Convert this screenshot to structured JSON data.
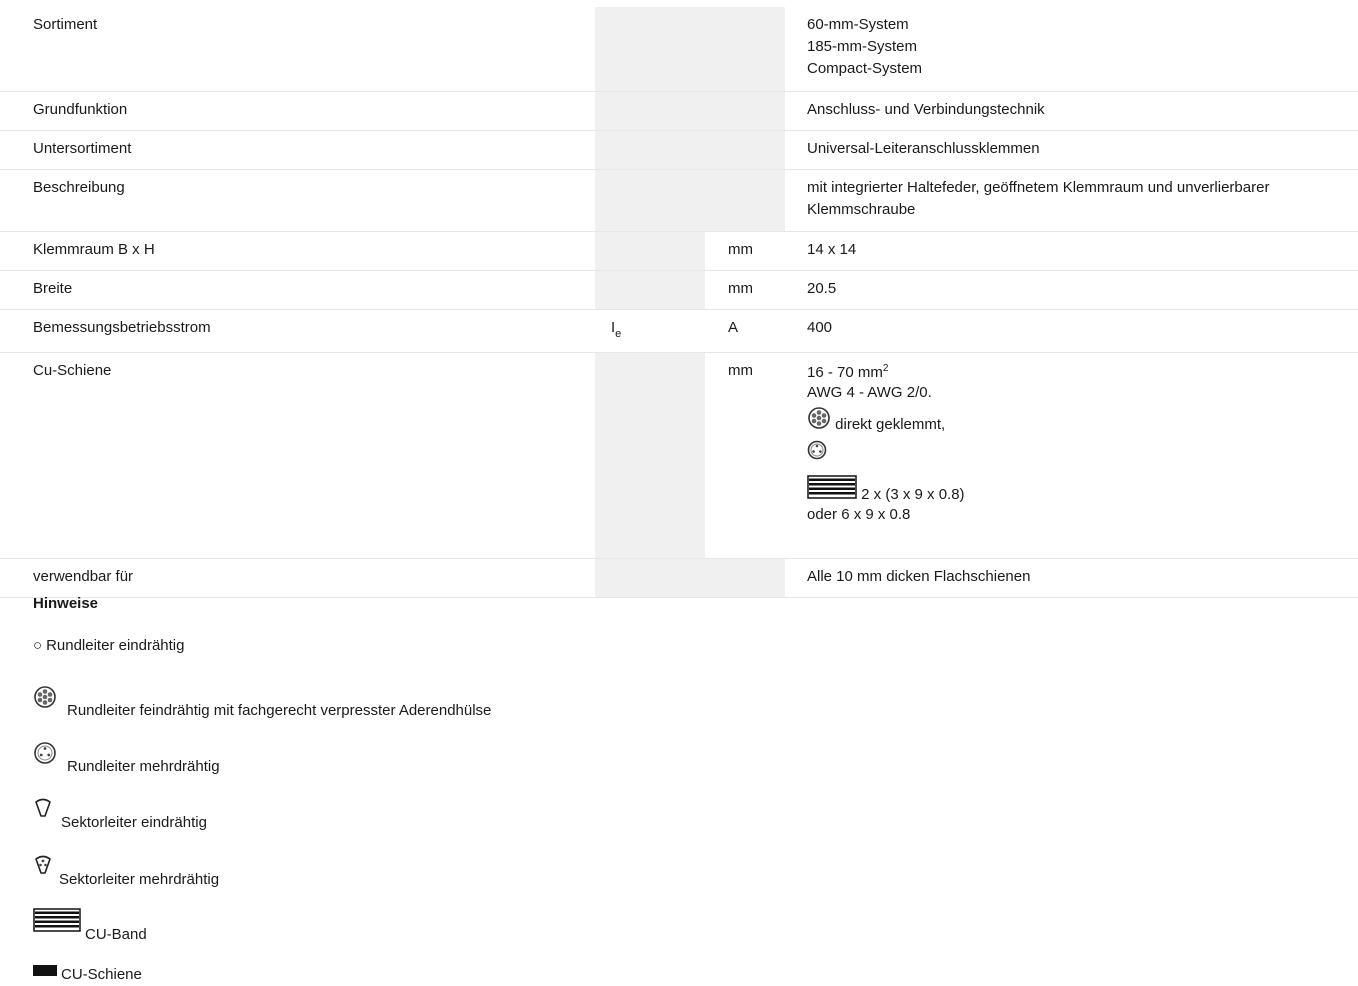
{
  "rows": [
    {
      "label": "Sortiment",
      "symbol": "",
      "unit": "",
      "values": [
        "60-mm-System",
        "185-mm-System",
        "Compact-System"
      ]
    },
    {
      "label": "Grundfunktion",
      "symbol": "",
      "unit": "",
      "values": [
        "Anschluss- und Verbindungstechnik"
      ]
    },
    {
      "label": "Untersortiment",
      "symbol": "",
      "unit": "",
      "values": [
        "Universal-Leiteranschlussklemmen"
      ]
    },
    {
      "label": "Beschreibung",
      "symbol": "",
      "unit": "",
      "values": [
        "mit integrierter Haltefeder, geöffnetem Klemmraum und unverlierbarer Klemmschraube"
      ]
    },
    {
      "label": "Klemmraum B x H",
      "symbol": "",
      "unit": "mm",
      "values": [
        "14 x 14"
      ]
    },
    {
      "label": "Breite",
      "symbol": "",
      "unit": "mm",
      "values": [
        "20.5"
      ]
    },
    {
      "label": "Bemessungsbetriebsstrom",
      "symbol_main": "I",
      "symbol_sub": "e",
      "unit": "A",
      "values": [
        "400"
      ]
    },
    {
      "label": "Cu-Schiene",
      "symbol": "",
      "unit": "mm",
      "cu": {
        "range": "16 - 70 mm",
        "range_sup": "2",
        "awg": "AWG 4 - AWG 2/0.",
        "direct": "direkt geklemmt,",
        "band": "2 x (3 x 9 x 0.8)",
        "alt": "oder 6 x 9 x 0.8"
      }
    },
    {
      "label": "verwendbar für",
      "symbol": "",
      "unit": "",
      "values": [
        "Alle 10 mm dicken Flachschienen"
      ]
    }
  ],
  "notes": {
    "title": "Hinweise",
    "items": [
      {
        "icon": "round-solid-conductor-icon",
        "label": "Rundleiter eindrähtig",
        "glyph": "○"
      },
      {
        "icon": "round-fine-stranded-conductor-icon",
        "label": "Rundleiter feindrähtig mit fachgerecht verpresster Aderendhülse"
      },
      {
        "icon": "round-stranded-conductor-icon",
        "label": "Rundleiter mehrdrähtig"
      },
      {
        "icon": "sector-solid-conductor-icon",
        "label": "Sektorleiter eindrähtig"
      },
      {
        "icon": "sector-stranded-conductor-icon",
        "label": "Sektorleiter mehrdrähtig"
      },
      {
        "icon": "cu-band-icon",
        "label": "CU-Band"
      },
      {
        "icon": "cu-rail-icon",
        "label": "CU-Schiene"
      }
    ]
  }
}
